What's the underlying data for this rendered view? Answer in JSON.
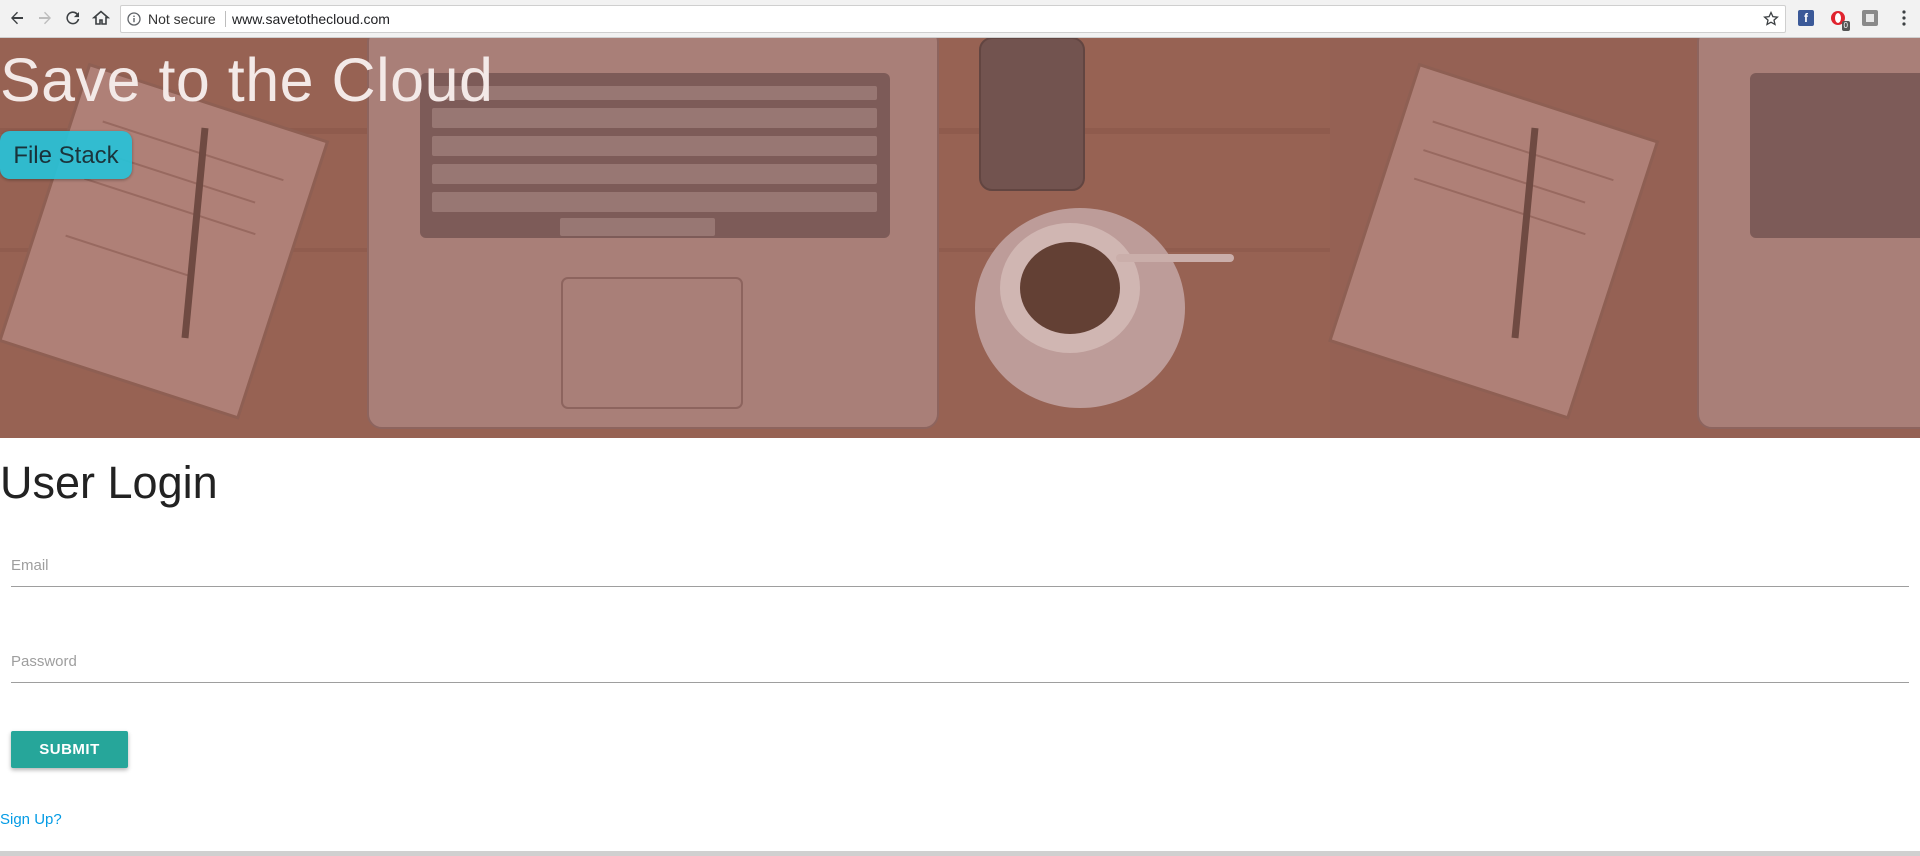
{
  "browser": {
    "security_label": "Not secure",
    "url": "www.savetothecloud.com",
    "extensions": {
      "facebook_letter": "f",
      "opera_badge": "0"
    }
  },
  "hero": {
    "title": "Save to the Cloud",
    "button_label": "File Stack",
    "overlay_color": "#9b6a5c"
  },
  "login": {
    "title": "User Login",
    "email_placeholder": "Email",
    "password_placeholder": "Password",
    "submit_label": "SUBMIT",
    "signup_link": "Sign Up?"
  },
  "colors": {
    "accent_teal": "#26a69a",
    "hero_button": "#28c2d8",
    "link_blue": "#039be5"
  }
}
